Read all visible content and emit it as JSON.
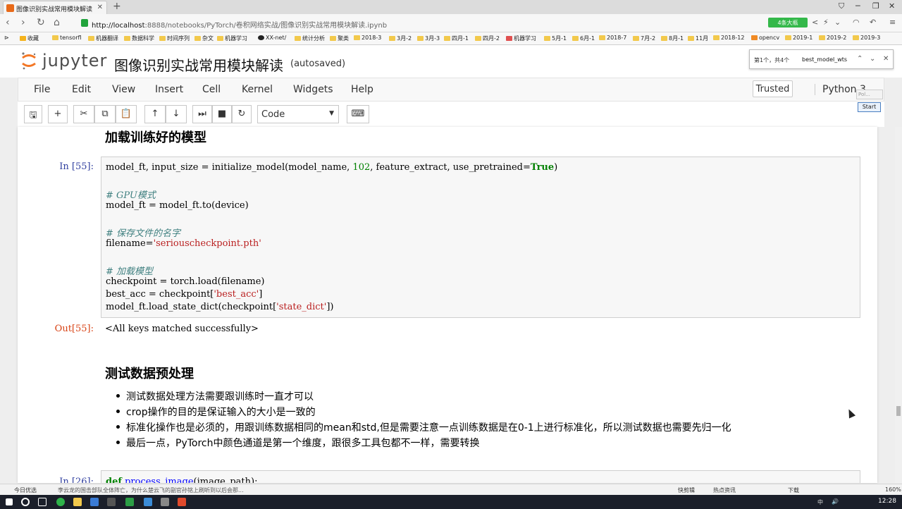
{
  "browser": {
    "tab_title": "图像识别实战常用模块解读",
    "url_host": "http://localhost",
    "url_rest": ":8888/notebooks/PyTorch/卷积网络实战/图像识别实战常用模块解读.ipynb",
    "badge": "4条大瓶",
    "bookmarks": [
      "收藏",
      "tensorfl",
      "机器翻译",
      "数据科学",
      "时间序列",
      "杂文",
      "机器学习",
      "XX-net/",
      "统计分析",
      "聚类",
      "2018-3",
      "3月-2",
      "3月-3",
      "四月-1",
      "四月-2",
      "机器学习",
      "5月-1",
      "6月-1",
      "2018-7",
      "7月-2",
      "8月-1",
      "11月",
      "2018-12",
      "opencv",
      "2019-1",
      "2019-2",
      "2019-3"
    ]
  },
  "find_bar": {
    "count": "第1个，共4个",
    "query": "best_model_wts"
  },
  "header": {
    "logo_text": "jupyter",
    "notebook_title": "图像识别实战常用模块解读",
    "autosaved": "(autosaved)"
  },
  "menubar": {
    "items": [
      "File",
      "Edit",
      "View",
      "Insert",
      "Cell",
      "Kernel",
      "Widgets",
      "Help"
    ],
    "trusted": "Trusted",
    "kernel": "Python 3"
  },
  "toolbar": {
    "cell_type": "Code",
    "start_label": "Start",
    "pol_label": "Pol..."
  },
  "cells": {
    "heading1": "加载训练好的模型",
    "in55": "In [55]:",
    "code55": {
      "l1a": "model_ft, input_size = initialize_model(model_name, ",
      "l1num": "102",
      "l1b": ", feature_extract, use_pretrained=",
      "l1kw": "True",
      "l1c": ")",
      "c1": "# GPU模式",
      "l2": "model_ft = model_ft.to(device)",
      "c2": "# 保存文件的名字",
      "l3a": "filename=",
      "l3s": "'seriouscheckpoint.pth'",
      "c3": "# 加载模型",
      "l4": "checkpoint = torch.load(filename)",
      "l5a": "best_acc = checkpoint[",
      "l5s": "'best_acc'",
      "l5b": "]",
      "l6a": "model_ft.load_state_dict(checkpoint[",
      "l6s": "'state_dict'",
      "l6b": "])"
    },
    "out55": "Out[55]:",
    "out55_text": "<All keys matched successfully>",
    "heading2": "测试数据预处理",
    "bullets": [
      "测试数据处理方法需要跟训练时一直才可以",
      "crop操作的目的是保证输入的大小是一致的",
      "标准化操作也是必须的，用跟训练数据相同的mean和std,但是需要注意一点训练数据是在0-1上进行标准化，所以测试数据也需要先归一化",
      "最后一点，PyTorch中颜色通道是第一个维度，跟很多工具包都不一样，需要转换"
    ],
    "in26": "In [26]:",
    "code26": {
      "kw": "def",
      "fn": "process_image",
      "rest": "(image_path):"
    }
  },
  "statusbar": {
    "left": "今日优选",
    "news": "李云龙的国击部队全体阵亡，为什么楚云飞的副官孙铭上刷听到以后会那...",
    "items": [
      "快剪辑",
      "热点资讯",
      "下载",
      "160%"
    ]
  },
  "taskbar": {
    "clock": "12:28",
    "ime": "中"
  }
}
